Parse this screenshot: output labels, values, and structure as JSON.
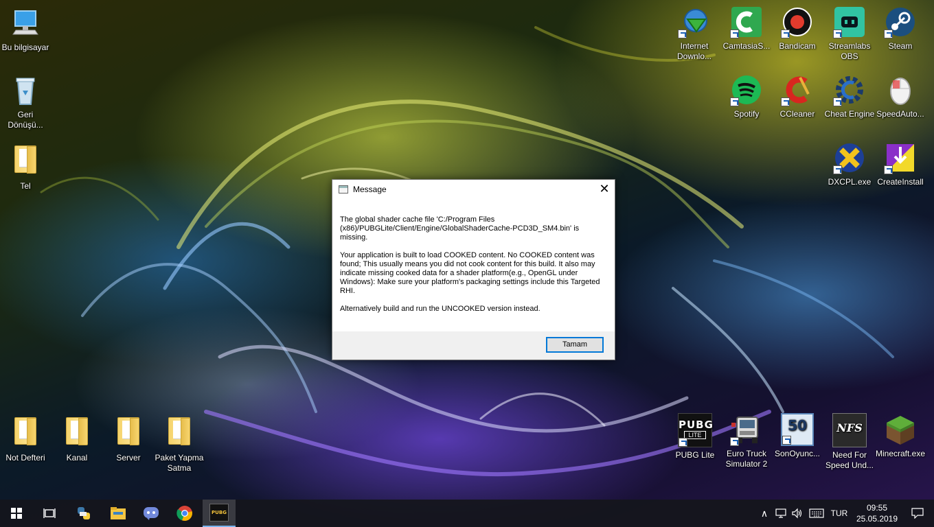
{
  "desktop_icons_left": [
    {
      "label": "Bu bilgisayar",
      "icon": "computer-icon"
    },
    {
      "label": "Geri Dönüşü...",
      "icon": "recycle-bin-icon"
    },
    {
      "label": "Tel",
      "icon": "folder-icon"
    }
  ],
  "desktop_icons_top_right": [
    {
      "label": "Internet Downlo...",
      "icon": "idm-icon"
    },
    {
      "label": "CamtasiaS...",
      "icon": "camtasia-icon"
    },
    {
      "label": "Bandicam",
      "icon": "bandicam-icon"
    },
    {
      "label": "Streamlabs OBS",
      "icon": "streamlabs-icon"
    },
    {
      "label": "Steam",
      "icon": "steam-icon"
    },
    {
      "label": "Spotify",
      "icon": "spotify-icon"
    },
    {
      "label": "CCleaner",
      "icon": "ccleaner-icon"
    },
    {
      "label": "Cheat Engine",
      "icon": "cheat-engine-icon"
    },
    {
      "label": "SpeedAuto...",
      "icon": "mouse-icon"
    },
    {
      "label": "DXCPL.exe",
      "icon": "dxcpl-icon"
    },
    {
      "label": "CreateInstall",
      "icon": "createinstall-icon"
    }
  ],
  "desktop_icons_bottom_left": [
    {
      "label": "Not Defteri",
      "icon": "folder-icon"
    },
    {
      "label": "Kanal",
      "icon": "folder-icon"
    },
    {
      "label": "Server",
      "icon": "folder-icon"
    },
    {
      "label": "Paket Yapma Satma",
      "icon": "folder-icon"
    }
  ],
  "desktop_icons_bottom_right": [
    {
      "label": "PUBG Lite",
      "icon": "pubg-icon",
      "logo_text": "PUBG",
      "logo_sub": "LITE"
    },
    {
      "label": "Euro Truck Simulator 2",
      "icon": "truck-icon"
    },
    {
      "label": "SonOyunc...",
      "icon": "sonoyuncu-icon",
      "logo_text": "50"
    },
    {
      "label": "Need For Speed Und...",
      "icon": "nfs-icon",
      "logo_text": "NFS"
    },
    {
      "label": "Minecraft.exe",
      "icon": "minecraft-icon"
    }
  ],
  "dialog": {
    "title": "Message",
    "close_glyph": "✕",
    "paragraphs": [
      "The global shader cache file 'C:/Program Files (x86)/PUBGLite/Client/Engine/GlobalShaderCache-PCD3D_SM4.bin' is missing.",
      "Your application is built to load COOKED content. No COOKED content was found; This usually means you did not cook content for this build. It also may indicate missing cooked data for a shader platform(e.g., OpenGL under Windows): Make sure your platform's packaging settings include this Targeted RHI.",
      "Alternatively build and run the UNCOOKED version instead."
    ],
    "ok_label": "Tamam"
  },
  "taskbar": {
    "pinned": [
      {
        "name": "start-button",
        "icon": "windows-logo-icon"
      },
      {
        "name": "task-view-button",
        "icon": "task-view-icon"
      },
      {
        "name": "taskbar-app-python",
        "icon": "python-icon"
      },
      {
        "name": "taskbar-app-explorer",
        "icon": "file-explorer-icon"
      },
      {
        "name": "taskbar-app-discord",
        "icon": "discord-icon"
      },
      {
        "name": "taskbar-app-chrome",
        "icon": "chrome-icon"
      },
      {
        "name": "taskbar-app-pubg",
        "icon": "pubg-icon",
        "active": true,
        "logo_text": "PUBG"
      }
    ],
    "tray": {
      "chevron": "∧",
      "language": "TUR",
      "time": "09:55",
      "date": "25.05.2019"
    }
  },
  "colors": {
    "taskbar_bg": "#16181e",
    "accent": "#0078d7",
    "dialog_footer": "#f0f0f0"
  }
}
